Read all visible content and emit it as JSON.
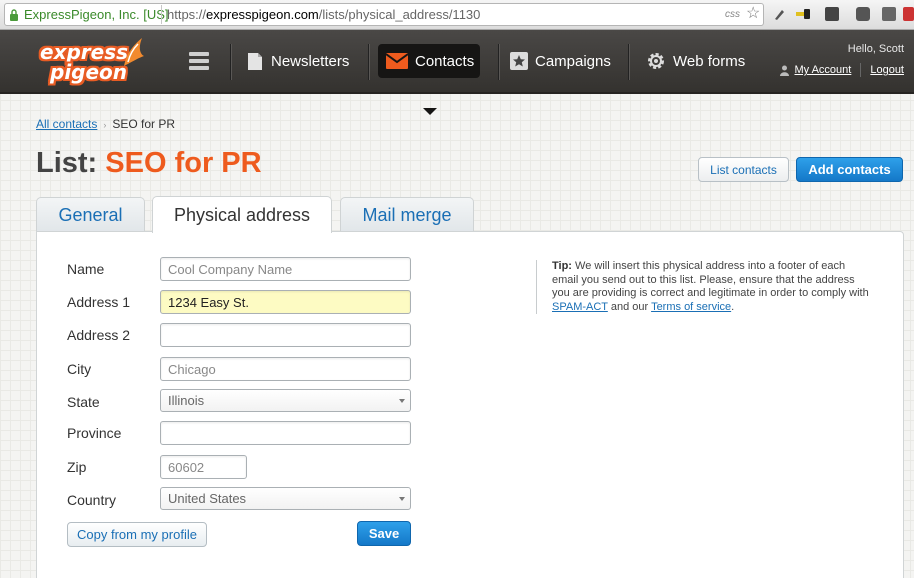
{
  "browser": {
    "site_identity": "ExpressPigeon, Inc. [US]",
    "url_prefix": "https://",
    "url_domain": "expresspigeon.com",
    "url_path": "/lists/physical_address/1130",
    "css_badge": "css"
  },
  "header": {
    "logo_line1": "express",
    "logo_line2": "pigeon",
    "nav": [
      {
        "label": "Newsletters",
        "icon": "newsletter-icon"
      },
      {
        "label": "Contacts",
        "icon": "envelope-icon",
        "active": true
      },
      {
        "label": "Campaigns",
        "icon": "star-icon"
      },
      {
        "label": "Web forms",
        "icon": "gear-icon"
      }
    ],
    "greeting": "Hello, Scott",
    "my_account": "My Account",
    "logout": "Logout"
  },
  "breadcrumb": {
    "parent": "All contacts",
    "separator": "›",
    "current": "SEO for PR"
  },
  "title": {
    "prefix": "List:",
    "name": "SEO for PR"
  },
  "actions": {
    "list_contacts": "List contacts",
    "add_contacts": "Add contacts"
  },
  "tabs": [
    {
      "label": "General"
    },
    {
      "label": "Physical address",
      "active": true
    },
    {
      "label": "Mail merge"
    }
  ],
  "form": {
    "name": {
      "label": "Name",
      "value": "",
      "placeholder": "Cool Company Name"
    },
    "address1": {
      "label": "Address 1",
      "value": "1234 Easy St.",
      "placeholder": ""
    },
    "address2": {
      "label": "Address 2",
      "value": "",
      "placeholder": ""
    },
    "city": {
      "label": "City",
      "value": "",
      "placeholder": "Chicago"
    },
    "state": {
      "label": "State",
      "selected": "Illinois"
    },
    "province": {
      "label": "Province",
      "value": "",
      "placeholder": ""
    },
    "zip": {
      "label": "Zip",
      "value": "",
      "placeholder": "60602"
    },
    "country": {
      "label": "Country",
      "selected": "United States"
    },
    "copy_button": "Copy from my profile",
    "save_button": "Save"
  },
  "tip": {
    "label": "Tip:",
    "text": " We will insert this physical address into a footer of each email you send out to this list. Please, ensure that the address you are providing is correct and legitimate in order to comply with ",
    "link1": "SPAM-ACT",
    "middle": " and our ",
    "link2": "Terms of service",
    "end": "."
  },
  "colors": {
    "accent_orange": "#ee5b1e",
    "link_blue": "#1a6fb5",
    "primary_button": "#1e8ad8",
    "header_bg": "#3e3c3a"
  }
}
